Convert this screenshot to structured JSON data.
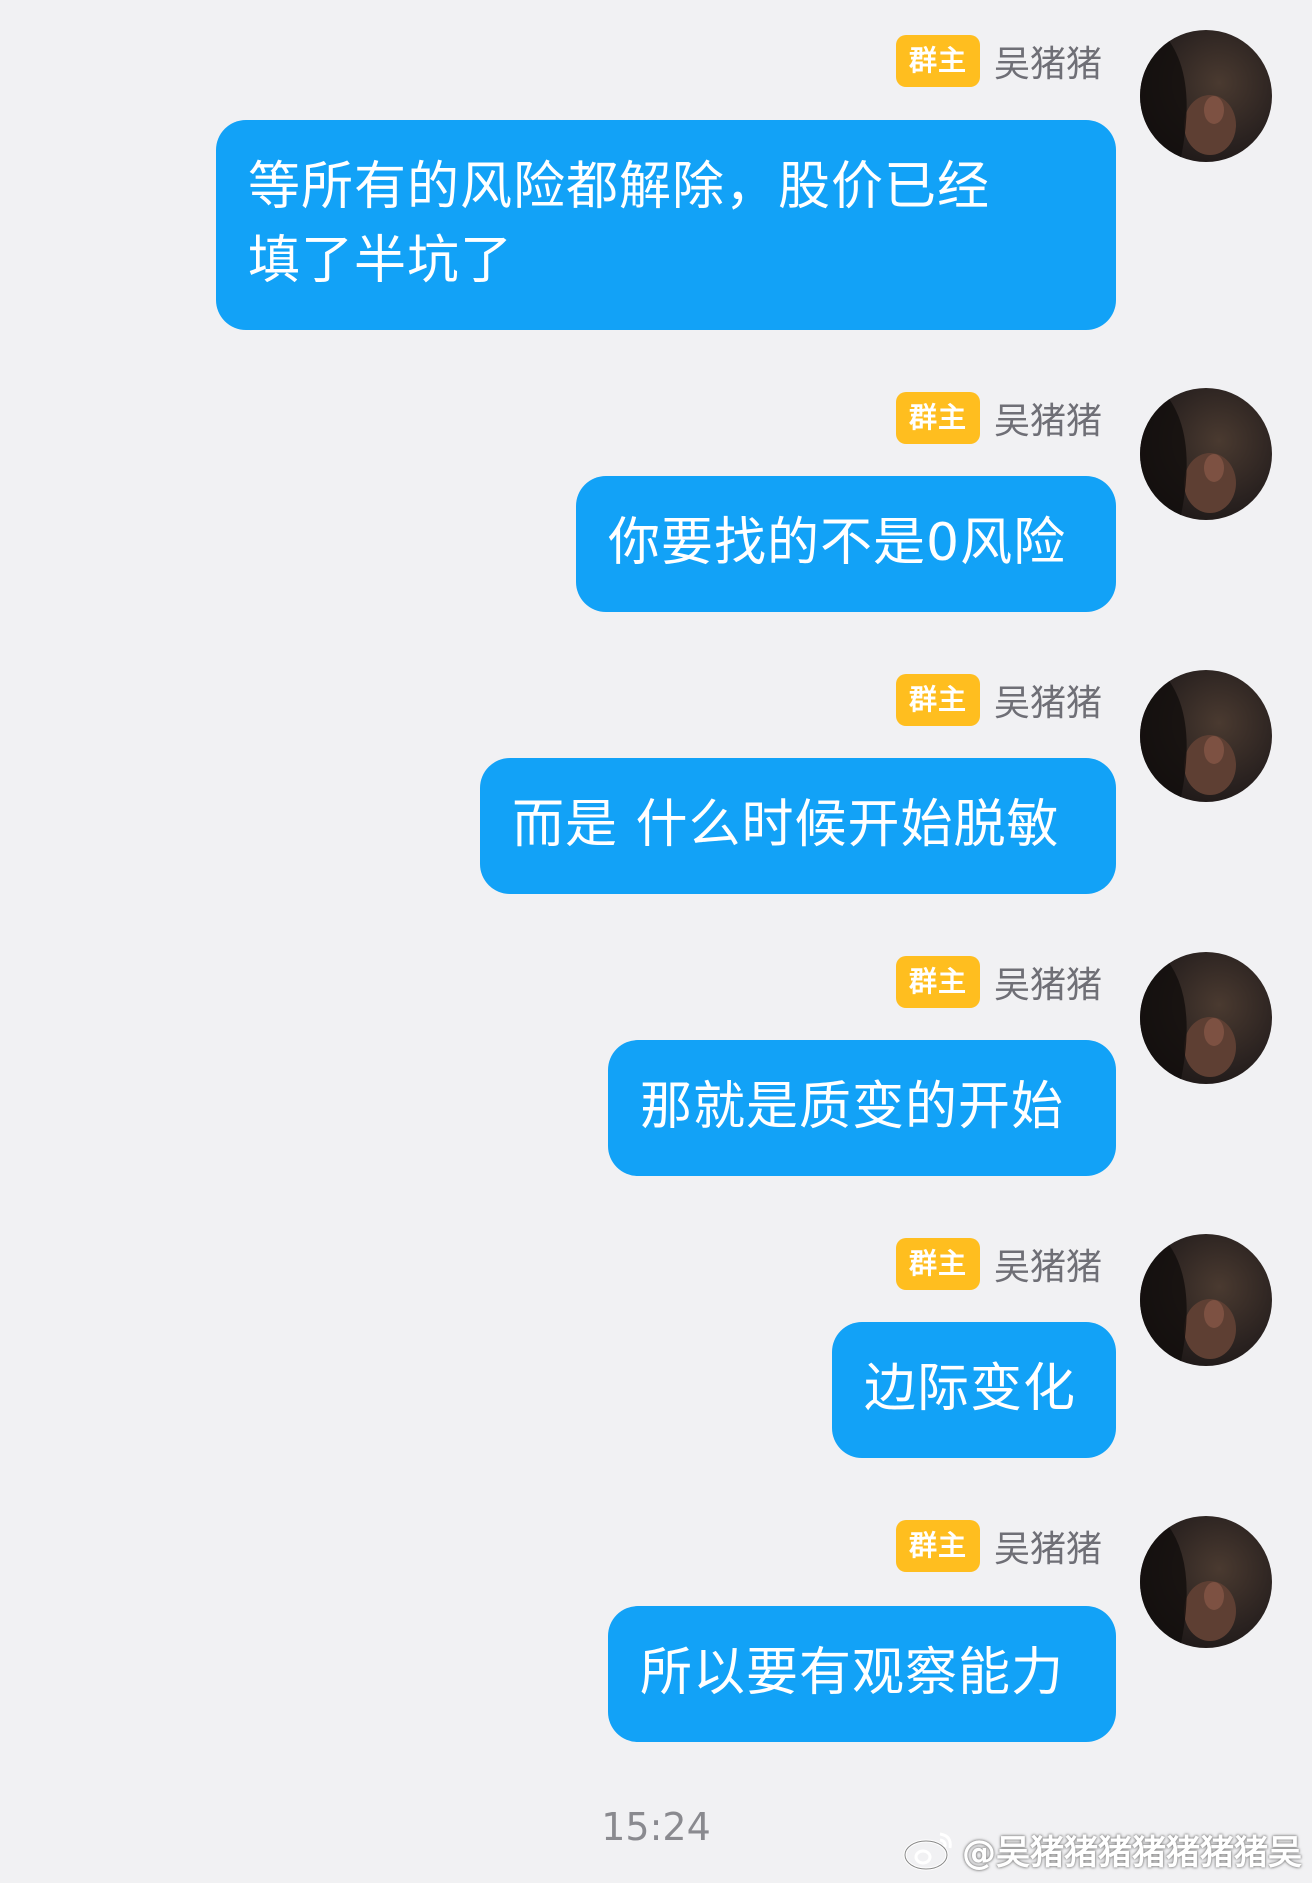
{
  "chat": {
    "messages": [
      {
        "badge": "群主",
        "sender": "吴猪猪",
        "text": "等所有的风险都解除，股价已经\n填了半坑了"
      },
      {
        "badge": "群主",
        "sender": "吴猪猪",
        "text": "你要找的不是0风险"
      },
      {
        "badge": "群主",
        "sender": "吴猪猪",
        "text": "而是 什么时候开始脱敏"
      },
      {
        "badge": "群主",
        "sender": "吴猪猪",
        "text": "那就是质变的开始"
      },
      {
        "badge": "群主",
        "sender": "吴猪猪",
        "text": "边际变化"
      },
      {
        "badge": "群主",
        "sender": "吴猪猪",
        "text": "所以要有观察能力"
      }
    ],
    "timestamp": "15:24"
  },
  "watermark": {
    "icon": "weibo-icon",
    "text": "@吴猪猪猪猪猪猪猪吴"
  },
  "colors": {
    "background": "#f1f1f3",
    "bubble": "#12a2f7",
    "badge": "#ffbe1f",
    "sender": "#6f6f76"
  }
}
